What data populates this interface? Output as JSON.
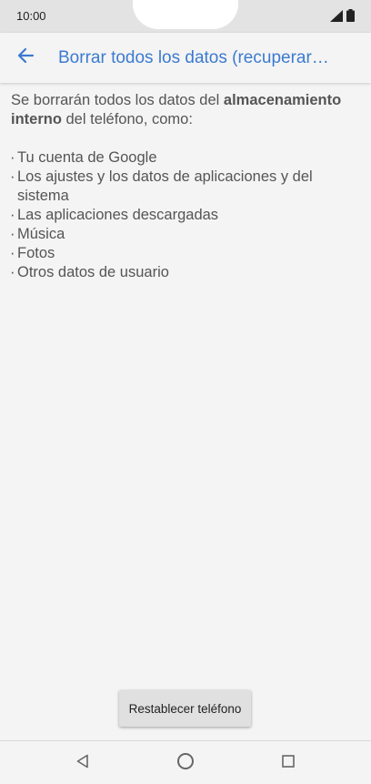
{
  "status_bar": {
    "time": "10:00",
    "icons": [
      "signal-icon",
      "battery-icon"
    ]
  },
  "app_bar": {
    "back_icon": "arrow-left-icon",
    "title": "Borrar todos los datos (recuperar…",
    "accent_color": "#3b7bd0"
  },
  "content": {
    "intro_prefix": "Se borrarán todos los datos del ",
    "intro_bold": "almacenamiento interno",
    "intro_suffix": " del teléfono, como:",
    "items": [
      "Tu cuenta de Google",
      "Los ajustes y los datos de aplicaciones y del sistema",
      "Las aplicaciones descargadas",
      "Música",
      "Fotos",
      "Otros datos de usuario"
    ]
  },
  "action": {
    "button_label": "Restablecer teléfono"
  },
  "nav_bar": {
    "icons": [
      "back-triangle-icon",
      "home-circle-icon",
      "recents-square-icon"
    ]
  }
}
